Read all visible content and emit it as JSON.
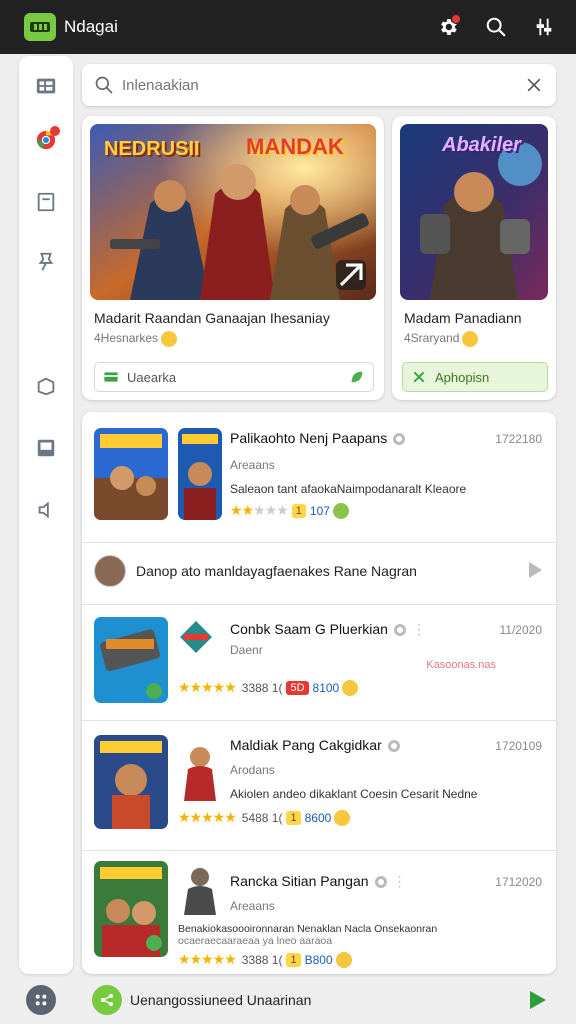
{
  "app": {
    "title": "Ndagai"
  },
  "colors": {
    "accent": "#7ac943",
    "topbar": "#222222",
    "badge": "#e53935"
  },
  "topbar": {
    "icons": [
      "gear-icon",
      "search-icon",
      "filter-icon"
    ]
  },
  "rail": {
    "icons": [
      "grid-icon",
      "chrome-icon",
      "document-icon",
      "pin-icon",
      "box-icon",
      "image-icon",
      "sound-icon"
    ]
  },
  "search": {
    "placeholder": "Inlenaakian"
  },
  "featured": [
    {
      "banner_left": "NEDRUSII",
      "banner_right": "MANDAK",
      "title": "Madarit Raandan Ganaajan Ihesaniay",
      "subtitle": "4Hesnarkes",
      "button": "Uaearka"
    },
    {
      "banner_left": "Abakiler",
      "title": "Madam Panadiann",
      "subtitle": "4Sraryand",
      "button": "Aphopisn"
    }
  ],
  "list": [
    {
      "title": "Palikaohto Nenj Paapans",
      "date": "1722180",
      "meta": "Areaans",
      "desc": "Saleaon tant afaokaNaimpodanaralt Kleaore",
      "rating": 2.5,
      "tag": "1",
      "count": "107"
    },
    {
      "comment": "Danop ato manldayagfaenakes Rane Nagran"
    },
    {
      "title": "Conbk Saam G Pluerkian",
      "date": "11/2020",
      "meta": "Daenr",
      "watermark": "Kasoonas.nas",
      "rating": 5,
      "rating_text": "3388 1(",
      "tag": "5D",
      "count": "8100"
    },
    {
      "title": "Maldiak Pang Cakgidkar",
      "date": "1720109",
      "meta": "Arodans",
      "desc": "Akiolen andeo dikaklant Coesin Cesarit Nedne",
      "rating": 5,
      "rating_text": "5488 1(",
      "tag": "1",
      "count": "8600"
    },
    {
      "title": "Rancka Sitian Pangan",
      "date": "1712020",
      "meta": "Areaans",
      "desc": "Benakiokasoooironnaran Nenaklan Nacla Onsekaonran",
      "desc2": "ocaeraecaaraeaa ya lneo aaraoa",
      "rating": 5,
      "rating_text": "3388 1(",
      "tag": "1",
      "count": "B800"
    }
  ],
  "bottom": {
    "input_value": "Uenangossiuneed Unaarinan"
  }
}
